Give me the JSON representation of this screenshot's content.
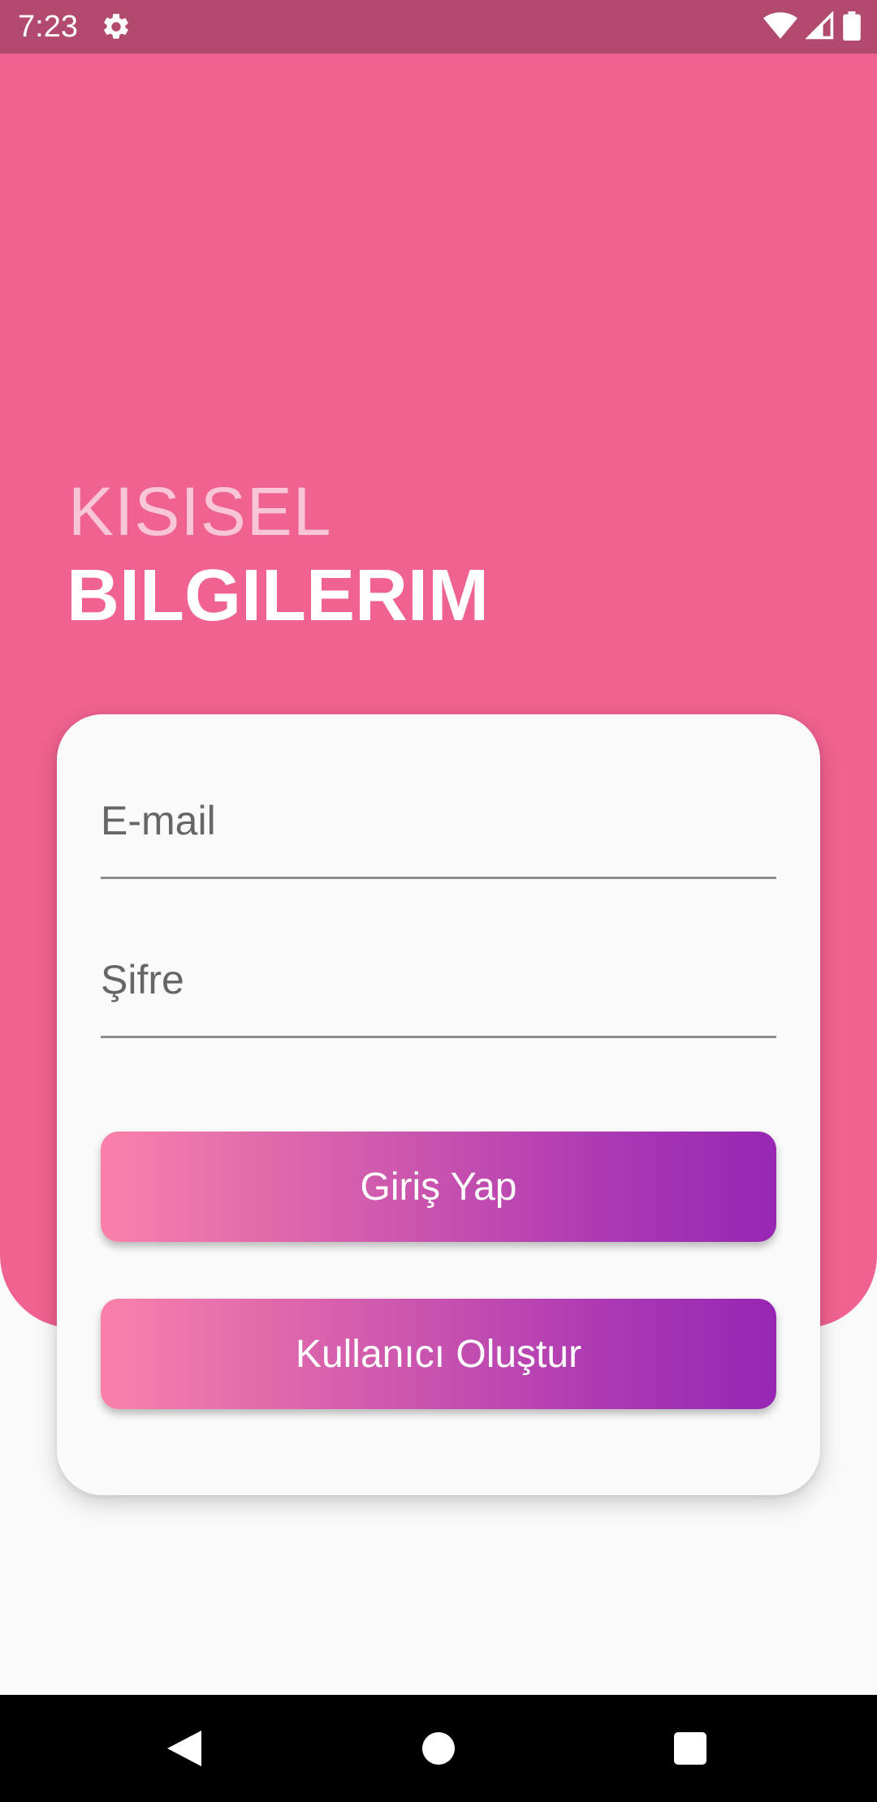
{
  "status_bar": {
    "time": "7:23",
    "icons": [
      "gear-icon",
      "wifi-icon",
      "signal-icon",
      "battery-icon"
    ],
    "background": "#b2496f"
  },
  "header": {
    "title_light": "KISISEL",
    "title_bold": "BILGILERIM"
  },
  "form": {
    "email": {
      "placeholder": "E-mail",
      "value": ""
    },
    "password": {
      "placeholder": "Şifre",
      "value": ""
    },
    "login_button": "Giriş Yap",
    "create_user_button": "Kullanıcı Oluştur"
  },
  "nav_bar": {
    "icons": [
      "back-icon",
      "home-icon",
      "recents-icon"
    ]
  },
  "colors": {
    "hero": "#f0628f",
    "gradient_start": "#fb81ab",
    "gradient_end": "#9727b3",
    "background": "#fafafa"
  }
}
